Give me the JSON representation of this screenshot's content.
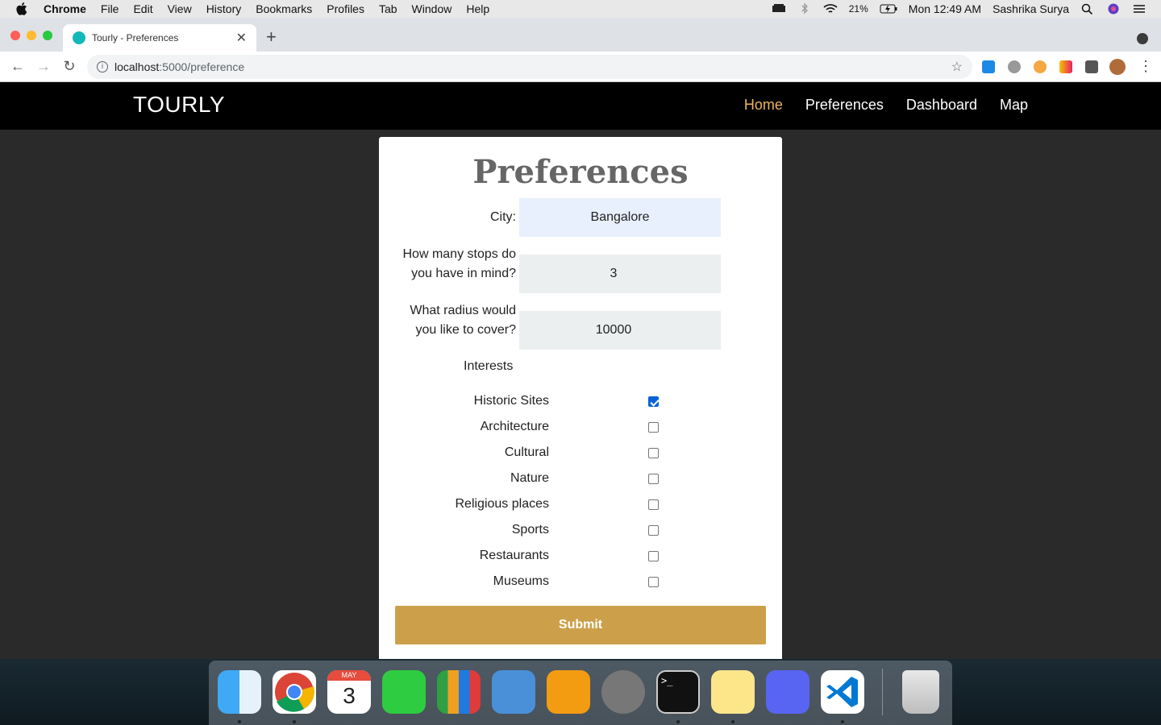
{
  "menubar": {
    "app": "Chrome",
    "items": [
      "File",
      "Edit",
      "View",
      "History",
      "Bookmarks",
      "Profiles",
      "Tab",
      "Window",
      "Help"
    ],
    "battery": "21%",
    "clock": "Mon 12:49 AM",
    "user": "Sashrika Surya"
  },
  "browser": {
    "tab_title": "Tourly - Preferences",
    "url_host": "localhost",
    "url_path": ":5000/preference"
  },
  "site": {
    "brand": "TOURLY",
    "nav": [
      {
        "label": "Home",
        "active": true
      },
      {
        "label": "Preferences",
        "active": false
      },
      {
        "label": "Dashboard",
        "active": false
      },
      {
        "label": "Map",
        "active": false
      }
    ]
  },
  "form": {
    "title": "Preferences",
    "city_label": "City:",
    "city_value": "Bangalore",
    "stops_label_line1": "How many stops do",
    "stops_label_line2": "you have in mind?",
    "stops_value": "3",
    "radius_label_line1": "What radius would",
    "radius_label_line2": "you like to cover?",
    "radius_value": "10000",
    "interests_label": "Interests",
    "interests": [
      {
        "label": "Historic Sites",
        "checked": true
      },
      {
        "label": "Architecture",
        "checked": false
      },
      {
        "label": "Cultural",
        "checked": false
      },
      {
        "label": "Nature",
        "checked": false
      },
      {
        "label": "Religious places",
        "checked": false
      },
      {
        "label": "Sports",
        "checked": false
      },
      {
        "label": "Restaurants",
        "checked": false
      },
      {
        "label": "Museums",
        "checked": false
      }
    ],
    "submit_label": "Submit"
  },
  "colors": {
    "nav_active": "#f0b35a",
    "submit_bg": "#cca04a",
    "city_input_bg": "#e8f0fe",
    "checkbox_checked": "#0a63d6"
  },
  "dock": {
    "apps": [
      "finder-icon",
      "chrome-icon",
      "calendar-icon",
      "facetime-icon",
      "numbers-icon",
      "keynote-icon",
      "pages-icon",
      "system-preferences-icon",
      "terminal-icon",
      "stickies-icon",
      "discord-icon",
      "vscode-icon",
      "trash-icon"
    ],
    "calendar_month": "MAY",
    "calendar_day": "3"
  }
}
